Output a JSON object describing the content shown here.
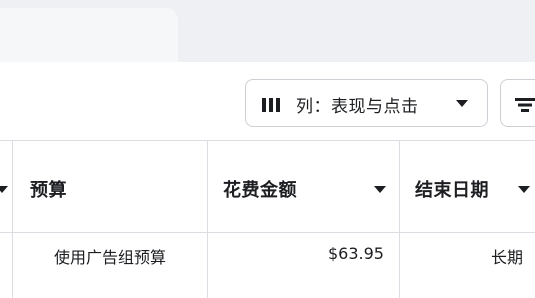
{
  "toolbar": {
    "columns_label": "列：表现与点击"
  },
  "table": {
    "columns": [
      "预算",
      "花费金额",
      "结束日期"
    ],
    "rows": [
      {
        "budget": "使用广告组预算",
        "spent": "$63.95",
        "end_date": "长期"
      }
    ]
  },
  "colors": {
    "tab_strip": "#eef0f3",
    "border": "#dadde1",
    "text": "#1c1e21"
  }
}
